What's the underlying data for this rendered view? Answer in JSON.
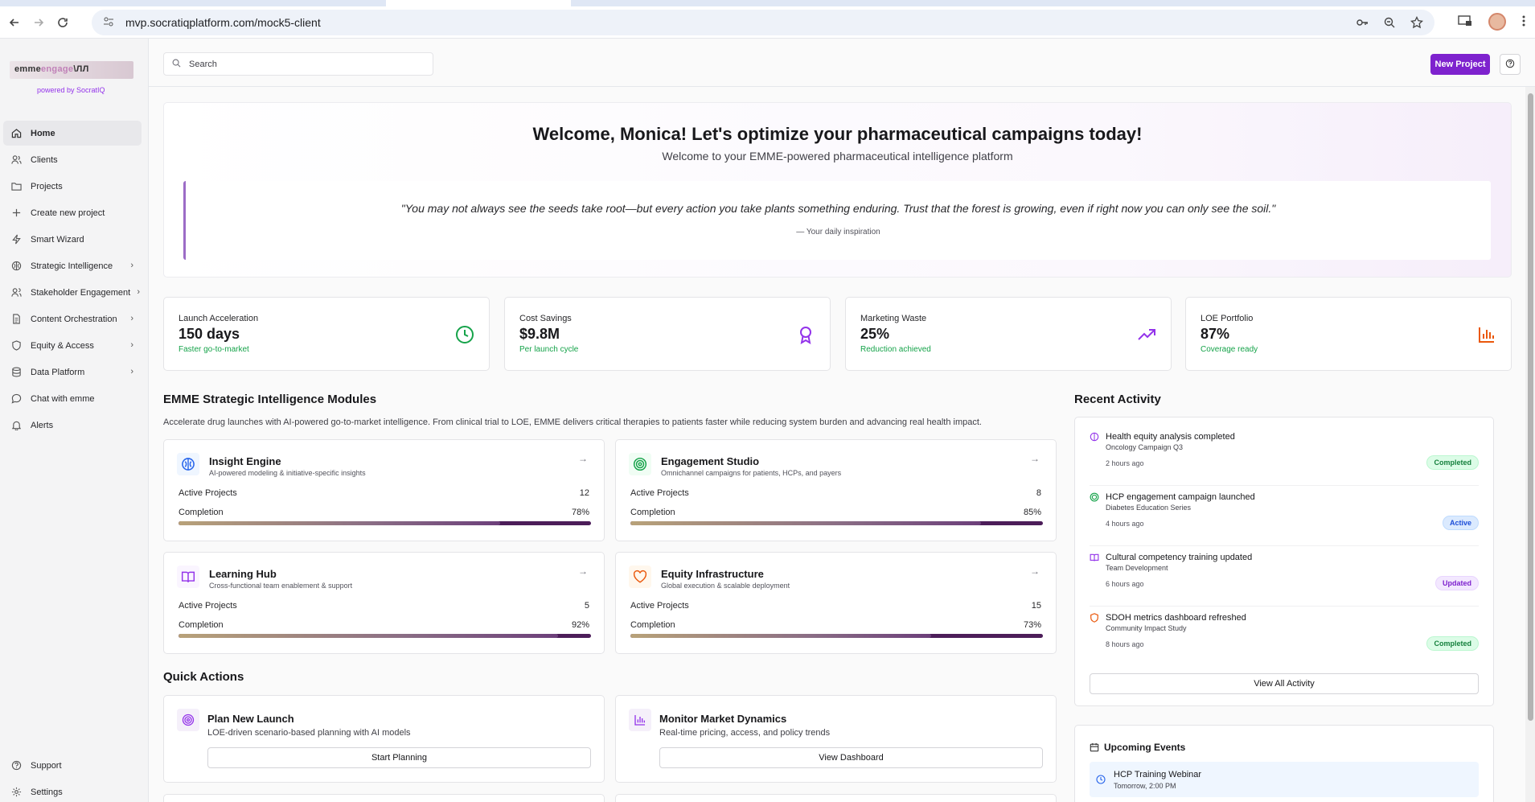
{
  "browser": {
    "url": "mvp.socratiqplatform.com/mock5-client"
  },
  "brand": {
    "logo_text_a": "emme",
    "logo_text_b": "engage",
    "logo_text_c": "\\ЛЛ",
    "powered_by": "powered by SocratIQ",
    "accent_color": "#7e22ce"
  },
  "sidebar": {
    "items": [
      {
        "label": "Home",
        "icon": "home-icon",
        "active": true,
        "expandable": false
      },
      {
        "label": "Clients",
        "icon": "users-icon",
        "expandable": false
      },
      {
        "label": "Projects",
        "icon": "folder-icon",
        "expandable": false
      },
      {
        "label": "Create new project",
        "icon": "plus-icon",
        "expandable": false
      },
      {
        "label": "Smart Wizard",
        "icon": "lightning-icon",
        "expandable": false
      },
      {
        "label": "Strategic Intelligence",
        "icon": "brain-icon",
        "expandable": true
      },
      {
        "label": "Stakeholder Engagement",
        "icon": "people-icon",
        "expandable": true
      },
      {
        "label": "Content Orchestration",
        "icon": "document-icon",
        "expandable": true
      },
      {
        "label": "Equity & Access",
        "icon": "shield-icon",
        "expandable": true
      },
      {
        "label": "Data Platform",
        "icon": "database-icon",
        "expandable": true
      },
      {
        "label": "Chat with emme",
        "icon": "chat-icon",
        "expandable": false
      },
      {
        "label": "Alerts",
        "icon": "bell-icon",
        "expandable": false
      }
    ],
    "bottom": [
      {
        "label": "Support",
        "icon": "help-circle-icon"
      },
      {
        "label": "Settings",
        "icon": "gear-icon"
      }
    ]
  },
  "appbar": {
    "search_placeholder": "Search",
    "new_project_label": "New Project"
  },
  "welcome": {
    "title": "Welcome, Monica! Let's optimize your pharmaceutical campaigns today!",
    "subtitle": "Welcome to your EMME-powered pharmaceutical intelligence platform",
    "quote": "\"You may not always see the seeds take root—but every action you take plants something enduring. Trust that the forest is growing, even if right now you can only see the soil.\"",
    "attribution": "— Your daily inspiration"
  },
  "stats": [
    {
      "label": "Launch Acceleration",
      "value": "150 days",
      "note": "Faster go-to-market",
      "icon": "clock-icon",
      "color": "#16a34a"
    },
    {
      "label": "Cost Savings",
      "value": "$9.8M",
      "note": "Per launch cycle",
      "icon": "award-icon",
      "color": "#9333ea"
    },
    {
      "label": "Marketing Waste",
      "value": "25%",
      "note": "Reduction achieved",
      "icon": "trending-up-icon",
      "color": "#9333ea"
    },
    {
      "label": "LOE Portfolio",
      "value": "87%",
      "note": "Coverage ready",
      "icon": "bar-chart-icon",
      "color": "#ea580c"
    }
  ],
  "modules_section": {
    "title": "EMME Strategic Intelligence Modules",
    "description": "Accelerate drug launches with AI-powered go-to-market intelligence. From clinical trial to LOE, EMME delivers critical therapies to patients faster while reducing system burden and advancing real health impact.",
    "active_label": "Active Projects",
    "completion_label": "Completion",
    "modules": [
      {
        "title": "Insight Engine",
        "description": "AI-powered modeling & initiative-specific insights",
        "active_projects": "12",
        "completion": 78,
        "completion_text": "78%",
        "icon": "brain-icon",
        "icon_color": "#2563eb"
      },
      {
        "title": "Engagement Studio",
        "description": "Omnichannel campaigns for patients, HCPs, and payers",
        "active_projects": "8",
        "completion": 85,
        "completion_text": "85%",
        "icon": "target-icon",
        "icon_color": "#16a34a"
      },
      {
        "title": "Learning Hub",
        "description": "Cross-functional team enablement & support",
        "active_projects": "5",
        "completion": 92,
        "completion_text": "92%",
        "icon": "book-icon",
        "icon_color": "#9333ea"
      },
      {
        "title": "Equity Infrastructure",
        "description": "Global execution & scalable deployment",
        "active_projects": "15",
        "completion": 73,
        "completion_text": "73%",
        "icon": "heart-icon",
        "icon_color": "#ea580c"
      }
    ]
  },
  "quick_actions": {
    "title": "Quick Actions",
    "items": [
      {
        "title": "Plan New Launch",
        "description": "LOE-driven scenario-based planning with AI models",
        "button": "Start Planning",
        "icon": "target-icon"
      },
      {
        "title": "Monitor Market Dynamics",
        "description": "Real-time pricing, access, and policy trends",
        "button": "View Dashboard",
        "icon": "bar-chart-icon"
      }
    ]
  },
  "recent_activity": {
    "title": "Recent Activity",
    "items": [
      {
        "title": "Health equity analysis completed",
        "subtitle": "Oncology Campaign Q3",
        "time": "2 hours ago",
        "status": "Completed",
        "status_type": "completed",
        "icon": "brain-icon",
        "icon_color": "#9333ea"
      },
      {
        "title": "HCP engagement campaign launched",
        "subtitle": "Diabetes Education Series",
        "time": "4 hours ago",
        "status": "Active",
        "status_type": "active",
        "icon": "target-icon",
        "icon_color": "#16a34a"
      },
      {
        "title": "Cultural competency training updated",
        "subtitle": "Team Development",
        "time": "6 hours ago",
        "status": "Updated",
        "status_type": "updated",
        "icon": "book-icon",
        "icon_color": "#9333ea"
      },
      {
        "title": "SDOH metrics dashboard refreshed",
        "subtitle": "Community Impact Study",
        "time": "8 hours ago",
        "status": "Completed",
        "status_type": "completed",
        "icon": "shield-icon",
        "icon_color": "#ea580c"
      }
    ],
    "view_all": "View All Activity"
  },
  "upcoming_events": {
    "title": "Upcoming Events",
    "items": [
      {
        "title": "HCP Training Webinar",
        "time": "Tomorrow, 2:00 PM"
      }
    ]
  }
}
